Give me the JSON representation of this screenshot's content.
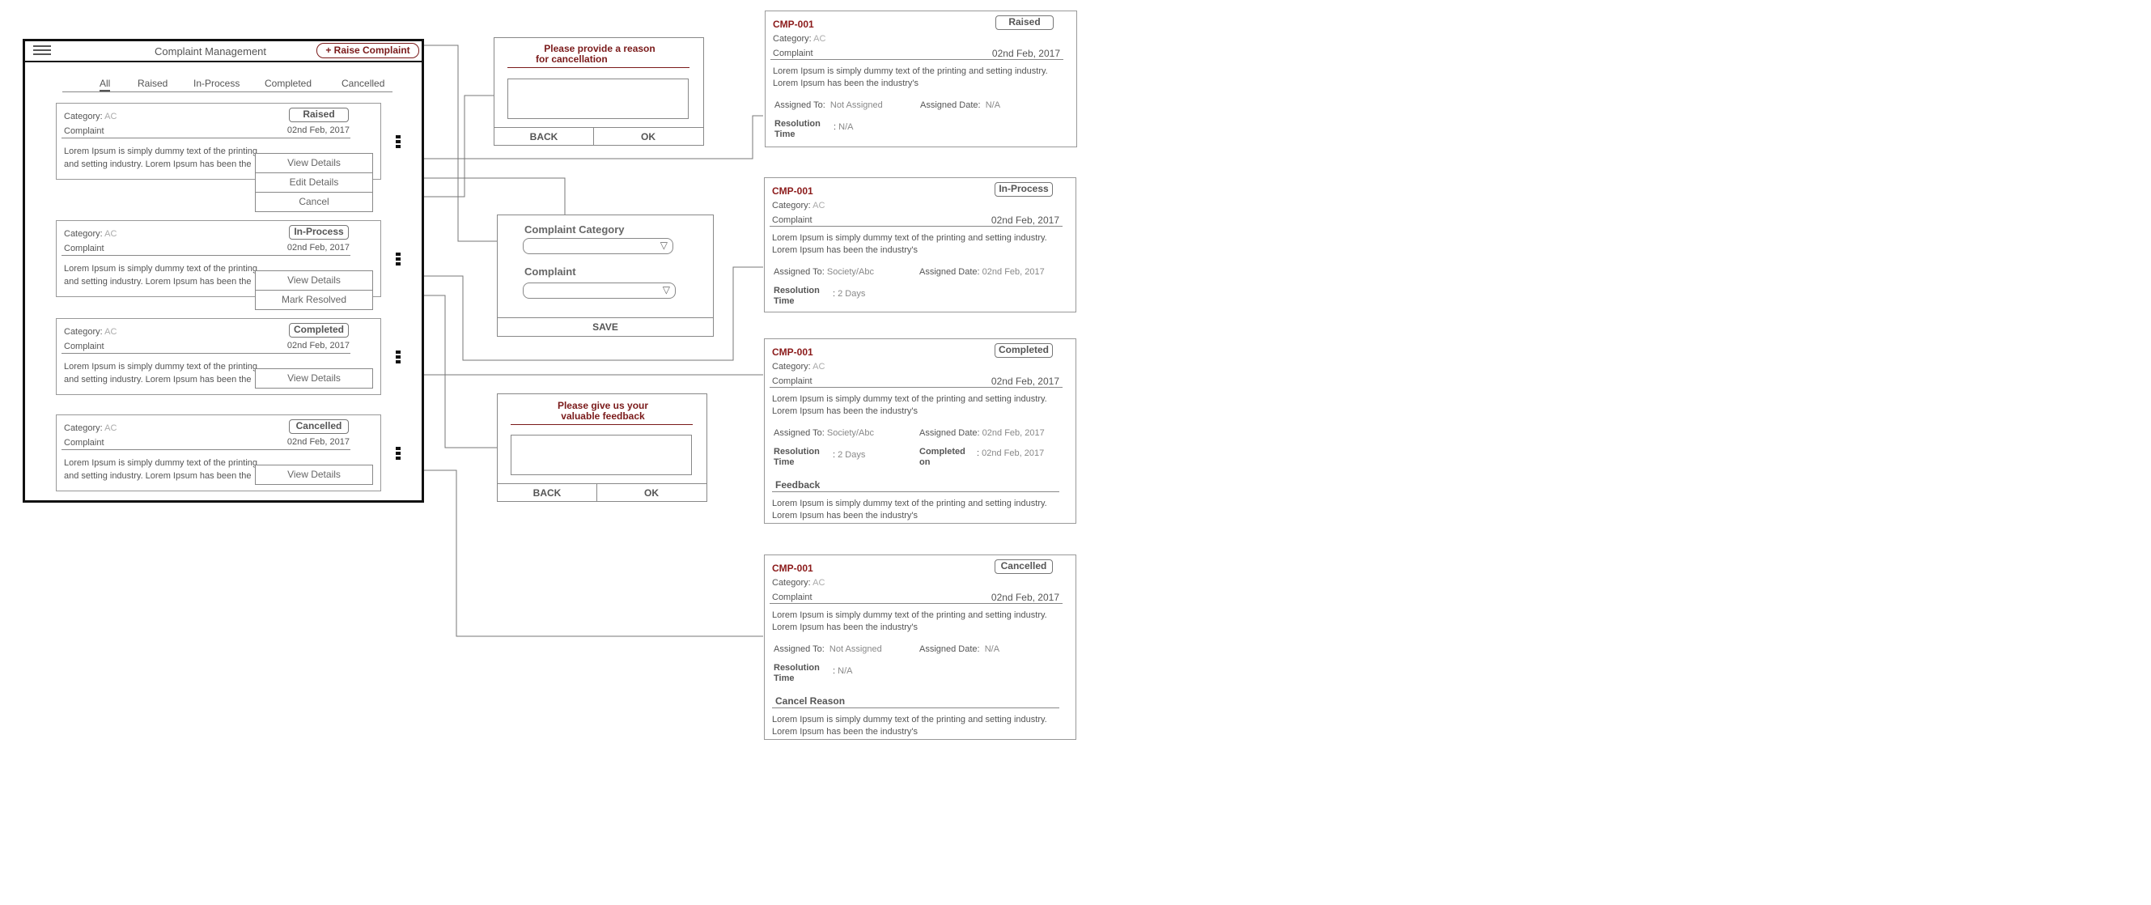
{
  "app": {
    "title": "Complaint Management",
    "raise_button": "+ Raise Complaint",
    "tabs": [
      "All",
      "Raised",
      "In-Process",
      "Completed",
      "Cancelled"
    ],
    "active_tab": "All"
  },
  "labels": {
    "category": "Category:",
    "complaint": "Complaint",
    "assigned_to": "Assigned To:",
    "assigned_date": "Assigned Date:",
    "resolution_time": "Resolution Time",
    "completed_on": "Completed on",
    "colon": ":"
  },
  "list_cards": [
    {
      "category": "AC",
      "status": "Raised",
      "date": "02nd Feb, 2017",
      "description": "Lorem Ipsum is simply dummy text of the printing and setting industry. Lorem Ipsum has been the industry's",
      "menu": [
        "View Details",
        "Edit Details",
        "Cancel"
      ]
    },
    {
      "category": "AC",
      "status": "In-Process",
      "date": "02nd Feb, 2017",
      "description": "Lorem Ipsum is simply dummy text of the printing and setting industry. Lorem Ipsum has been the industry's",
      "menu": [
        "View Details",
        "Mark Resolved"
      ]
    },
    {
      "category": "AC",
      "status": "Completed",
      "date": "02nd Feb, 2017",
      "description": "Lorem Ipsum is simply dummy text of the printing and setting industry. Lorem Ipsum has been the industry's",
      "menu": [
        "View Details"
      ]
    },
    {
      "category": "AC",
      "status": "Cancelled",
      "date": "02nd Feb, 2017",
      "description": "Lorem Ipsum is simply dummy text of the printing and setting industry. Lorem Ipsum has been the industry's",
      "menu": [
        "View Details"
      ]
    }
  ],
  "cancel_dialog": {
    "title_line1": "Please provide a reason",
    "title_line2": "for cancellation",
    "back": "BACK",
    "ok": "OK"
  },
  "edit_dialog": {
    "category_label": "Complaint Category",
    "complaint_label": "Complaint",
    "save": "SAVE"
  },
  "feedback_dialog": {
    "title_line1": "Please give us your",
    "title_line2": "valuable feedback",
    "back": "BACK",
    "ok": "OK"
  },
  "details": [
    {
      "id": "CMP-001",
      "status": "Raised",
      "category": "AC",
      "date": "02nd Feb, 2017",
      "description": "Lorem Ipsum is simply dummy text of the printing and setting industry. Lorem Ipsum has been the industry's",
      "assigned_to": "Not Assigned",
      "assigned_date": "N/A",
      "resolution_time": "N/A"
    },
    {
      "id": "CMP-001",
      "status": "In-Process",
      "category": "AC",
      "date": "02nd Feb, 2017",
      "description": "Lorem Ipsum is simply dummy text of the printing and setting industry. Lorem Ipsum has been the industry's",
      "assigned_to": "Society/Abc",
      "assigned_date": "02nd Feb, 2017",
      "resolution_time": "2 Days"
    },
    {
      "id": "CMP-001",
      "status": "Completed",
      "category": "AC",
      "date": "02nd Feb, 2017",
      "description": "Lorem Ipsum is simply dummy text of the printing and setting industry. Lorem Ipsum has been the industry's",
      "assigned_to": "Society/Abc",
      "assigned_date": "02nd Feb, 2017",
      "resolution_time": "2 Days",
      "completed_on": "02nd Feb, 2017",
      "section_title": "Feedback",
      "section_text": "Lorem Ipsum is simply dummy text of the printing and setting industry. Lorem Ipsum has been the industry's"
    },
    {
      "id": "CMP-001",
      "status": "Cancelled",
      "category": "AC",
      "date": "02nd Feb, 2017",
      "description": "Lorem Ipsum is simply dummy text of the printing and setting industry. Lorem Ipsum has been the industry's",
      "assigned_to": "Not Assigned",
      "assigned_date": "N/A",
      "resolution_time": "N/A",
      "section_title": "Cancel Reason",
      "section_text": "Lorem Ipsum is simply dummy text of the printing and setting industry. Lorem Ipsum has been the industry's"
    }
  ]
}
